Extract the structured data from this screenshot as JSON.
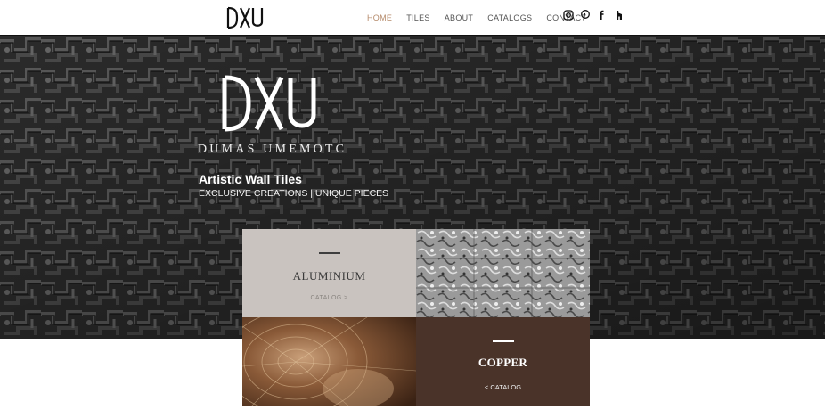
{
  "header": {
    "logo_text": "DXU",
    "nav": [
      {
        "label": "HOME",
        "active": true
      },
      {
        "label": "TILES",
        "active": false
      },
      {
        "label": "ABOUT",
        "active": false
      },
      {
        "label": "CATALOGS",
        "active": false
      },
      {
        "label": "CONTACT",
        "active": false
      }
    ],
    "social": [
      "instagram-icon",
      "pinterest-icon",
      "facebook-icon",
      "houzz-icon"
    ]
  },
  "hero": {
    "logo_text": "DXU",
    "brand": "DUMAS UMEMOTC",
    "tagline": "Artistic Wall Tiles",
    "subtitle": "EXCLUSIVE CREATIONS | UNIQUE PIECES"
  },
  "tiles": {
    "aluminium": {
      "title": "ALUMINIUM",
      "link": "CATALOG >"
    },
    "copper": {
      "title": "COPPER",
      "link": "< CATALOG"
    }
  },
  "colors": {
    "accent": "#b58a6a",
    "aluminium_bg": "#c9c3bf",
    "copper_bg": "#4a3329"
  }
}
